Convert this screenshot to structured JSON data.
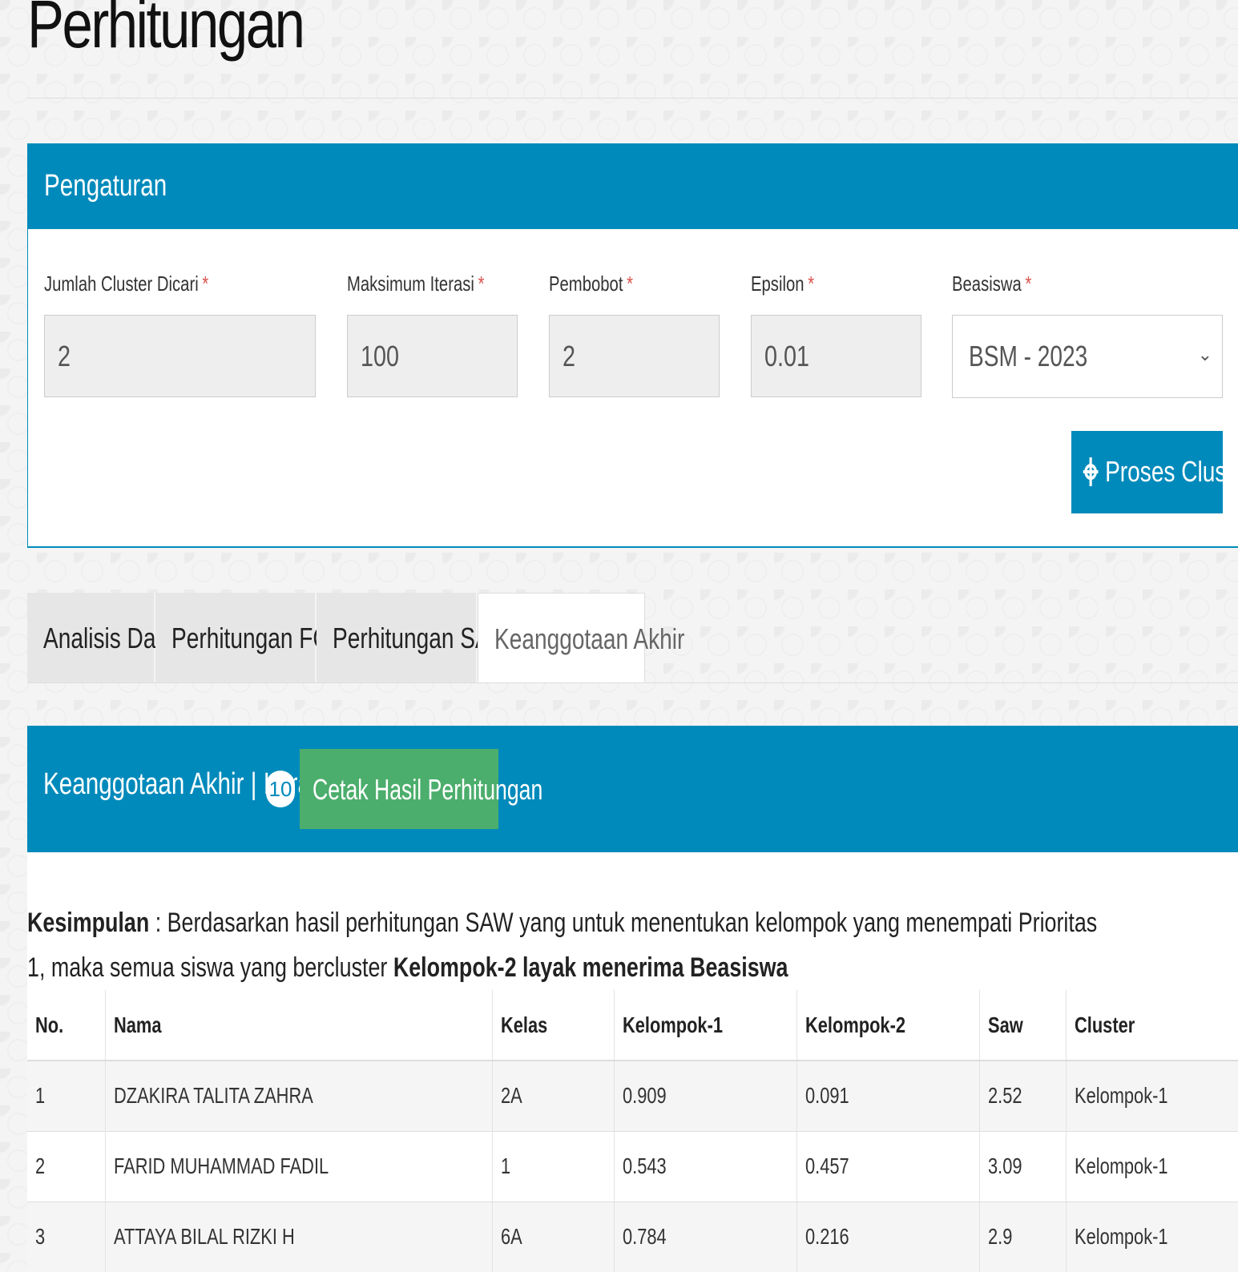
{
  "page": {
    "title": "Perhitungan"
  },
  "settings": {
    "header": "Pengaturan",
    "fields": [
      {
        "label": "Jumlah Cluster Dicari",
        "required": "*",
        "value": "2"
      },
      {
        "label": "Maksimum Iterasi",
        "required": "*",
        "value": "100"
      },
      {
        "label": "Pembobot",
        "required": "*",
        "value": "2"
      },
      {
        "label": "Epsilon",
        "required": "*",
        "value": "0.01"
      }
    ],
    "beasiswa": {
      "label": "Beasiswa",
      "required": "*",
      "selected": "BSM - 2023"
    },
    "process_button": "Proses Cluster"
  },
  "tabs": [
    {
      "label": "Analisis Data",
      "active": false
    },
    {
      "label": "Perhitungan FCM",
      "active": false
    },
    {
      "label": "Perhitungan SAW",
      "active": false
    },
    {
      "label": "Keanggotaan Akhir",
      "active": true
    }
  ],
  "result": {
    "header": "Keanggotaan Akhir | Iterasi",
    "iteration_badge": "10",
    "print_button": "Cetak Hasil Perhitungan",
    "conclusion": {
      "label": "Kesimpulan",
      "text": " : Berdasarkan hasil perhitungan SAW yang untuk menentukan kelompok yang menempati Prioritas 1, maka semua siswa yang bercluster ",
      "highlight": "Kelompok-2 layak menerima Beasiswa"
    },
    "table": {
      "columns": [
        "No.",
        "Nama",
        "Kelas",
        "Kelompok-1",
        "Kelompok-2",
        "Saw",
        "Cluster"
      ],
      "rows": [
        [
          "1",
          "DZAKIRA TALITA ZAHRA",
          "2A",
          "0.909",
          "0.091",
          "2.52",
          "Kelompok-1"
        ],
        [
          "2",
          "FARID MUHAMMAD FADIL",
          "1",
          "0.543",
          "0.457",
          "3.09",
          "Kelompok-1"
        ],
        [
          "3",
          "ATTAYA BILAL RIZKI H",
          "6A",
          "0.784",
          "0.216",
          "2.9",
          "Kelompok-1"
        ]
      ]
    }
  },
  "colors": {
    "primary": "#008abb",
    "success": "#4cae6c",
    "required": "#d9534f"
  },
  "icons": {
    "process": "crosshair-icon",
    "select": "chevron-down-icon"
  }
}
